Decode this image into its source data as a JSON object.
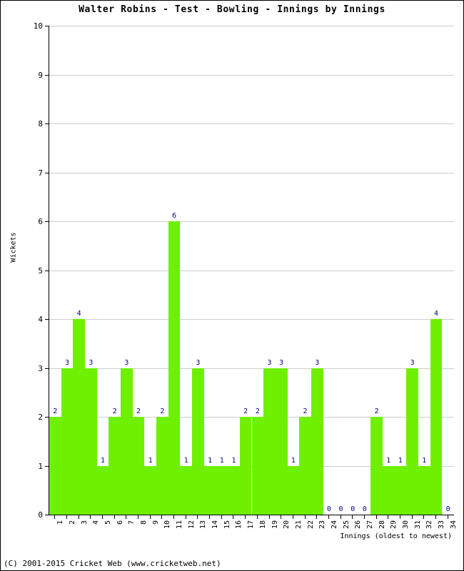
{
  "chart_data": {
    "type": "bar",
    "title": "Walter Robins - Test - Bowling - Innings by Innings",
    "xlabel": "Innings (oldest to newest)",
    "ylabel": "Wickets",
    "grid": true,
    "legend": null,
    "bar_color": "#6ef000",
    "value_label_color": "#000080",
    "ylim": [
      0,
      10
    ],
    "yticks": [
      0,
      1,
      2,
      3,
      4,
      5,
      6,
      7,
      8,
      9,
      10
    ],
    "categories": [
      "1",
      "2",
      "3",
      "4",
      "5",
      "6",
      "7",
      "8",
      "9",
      "10",
      "11",
      "12",
      "13",
      "14",
      "15",
      "16",
      "17",
      "18",
      "19",
      "20",
      "21",
      "22",
      "23",
      "24",
      "25",
      "26",
      "27",
      "28",
      "29",
      "30",
      "31",
      "32",
      "33",
      "34"
    ],
    "values": [
      2,
      3,
      4,
      3,
      1,
      2,
      3,
      2,
      1,
      2,
      6,
      1,
      3,
      1,
      1,
      1,
      2,
      2,
      3,
      3,
      1,
      2,
      3,
      0,
      0,
      0,
      0,
      2,
      1,
      1,
      3,
      1,
      4,
      0
    ]
  },
  "footer": {
    "copyright": "(C) 2001-2015 Cricket Web (www.cricketweb.net)"
  }
}
